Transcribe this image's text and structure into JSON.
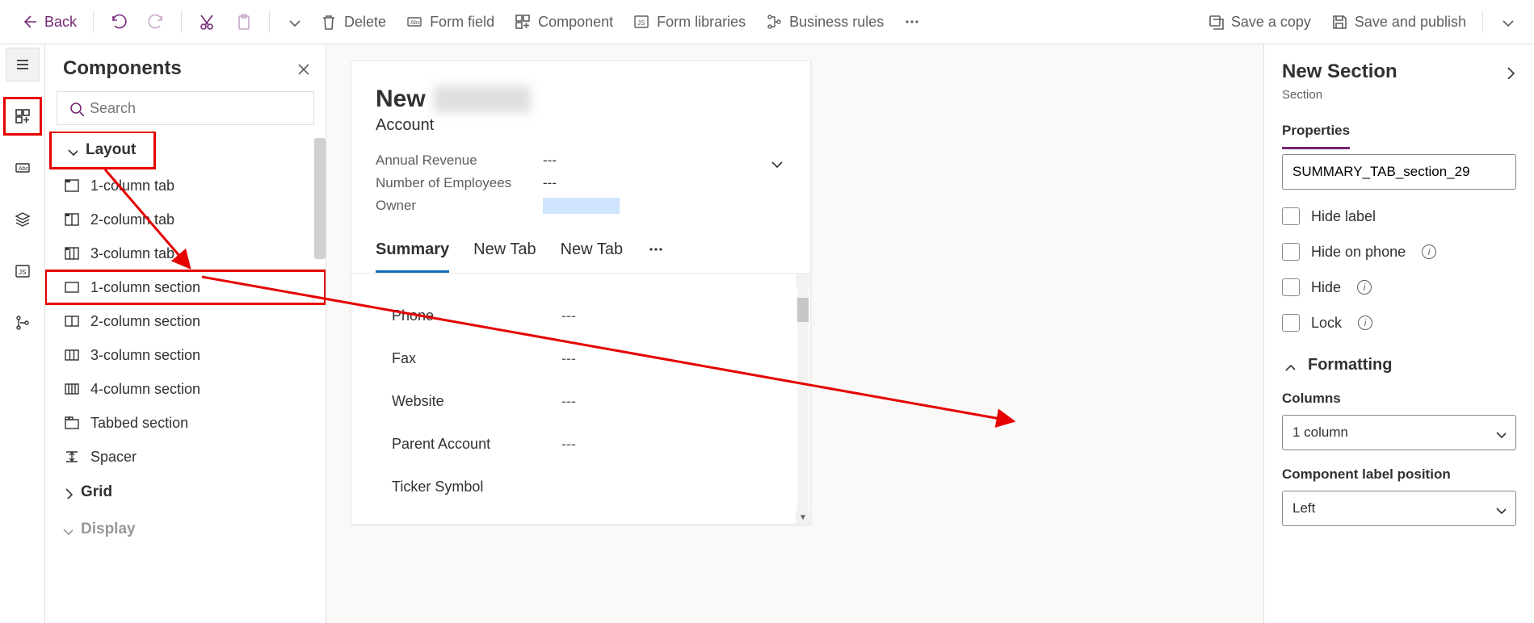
{
  "toolbar": {
    "back": "Back",
    "delete": "Delete",
    "formfield": "Form field",
    "component": "Component",
    "formlibs": "Form libraries",
    "bizrules": "Business rules",
    "savecopy": "Save a copy",
    "savepub": "Save and publish"
  },
  "components": {
    "title": "Components",
    "search_placeholder": "Search",
    "groups": {
      "layout": "Layout",
      "grid": "Grid",
      "display": "Display"
    },
    "layout_items": [
      "1-column tab",
      "2-column tab",
      "3-column tab",
      "1-column section",
      "2-column section",
      "3-column section",
      "4-column section",
      "Tabbed section",
      "Spacer"
    ]
  },
  "form": {
    "title_prefix": "New",
    "title_blur": "Account",
    "entity": "Account",
    "header_fields": [
      {
        "label": "Annual Revenue",
        "value": "---"
      },
      {
        "label": "Number of Employees",
        "value": "---"
      },
      {
        "label": "Owner",
        "value": ""
      }
    ],
    "tabs": [
      "Summary",
      "New Tab",
      "New Tab"
    ],
    "body_rows": [
      {
        "label": "Phone",
        "value": "---"
      },
      {
        "label": "Fax",
        "value": "---"
      },
      {
        "label": "Website",
        "value": "---"
      },
      {
        "label": "Parent Account",
        "value": "---"
      },
      {
        "label": "Ticker Symbol",
        "value": ""
      }
    ]
  },
  "props": {
    "title": "New Section",
    "subtitle": "Section",
    "tab": "Properties",
    "name_value": "SUMMARY_TAB_section_29",
    "checks": {
      "hide_label": "Hide label",
      "hide_phone": "Hide on phone",
      "hide": "Hide",
      "lock": "Lock"
    },
    "formatting": "Formatting",
    "columns_label": "Columns",
    "columns_value": "1 column",
    "clp_label": "Component label position",
    "clp_value": "Left"
  }
}
